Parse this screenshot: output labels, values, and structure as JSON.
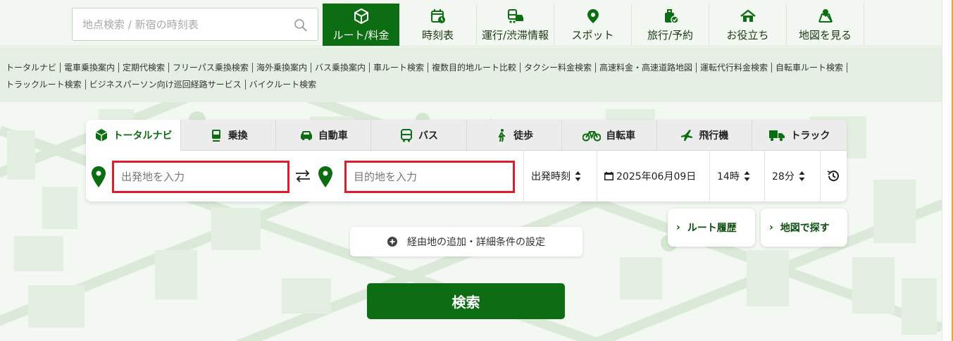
{
  "header": {
    "search_placeholder": "地点検索 / 新宿の時刻表",
    "nav": [
      {
        "label": "ルート/料金",
        "icon": "route-box-icon",
        "active": true
      },
      {
        "label": "時刻表",
        "icon": "calendar-clock-icon"
      },
      {
        "label": "運行/渋滞情報",
        "icon": "train-car-icon"
      },
      {
        "label": "スポット",
        "icon": "pin-icon"
      },
      {
        "label": "旅行/予約",
        "icon": "suitcase-icon"
      },
      {
        "label": "お役立ち",
        "icon": "house-icon"
      },
      {
        "label": "地図を見る",
        "icon": "map-pin-icon"
      }
    ]
  },
  "sublinks": {
    "line1": [
      "トータルナビ",
      "電車乗換案内",
      "定期代検索",
      "フリーパス乗換検索",
      "海外乗換案内",
      "バス乗換案内",
      "車ルート検索",
      "複数目的地ルート比較",
      "タクシー料金検索",
      "高速料金・高速道路地図",
      "運転代行料金検索",
      "自転車ルート検索"
    ],
    "line2": [
      "トラックルート検索",
      "ビジネスパーソン向け巡回経路サービス",
      "バイクルート検索"
    ]
  },
  "tabs": [
    {
      "label": "トータルナビ",
      "icon": "box-icon"
    },
    {
      "label": "乗換",
      "icon": "train-icon"
    },
    {
      "label": "自動車",
      "icon": "car-icon"
    },
    {
      "label": "バス",
      "icon": "bus-icon"
    },
    {
      "label": "徒歩",
      "icon": "walk-icon"
    },
    {
      "label": "自転車",
      "icon": "bicycle-icon"
    },
    {
      "label": "飛行機",
      "icon": "plane-icon"
    },
    {
      "label": "トラック",
      "icon": "truck-icon"
    }
  ],
  "form": {
    "from_placeholder": "出発地を入力",
    "to_placeholder": "目的地を入力",
    "time_mode": "出発時刻",
    "date": "2025年06月09日",
    "hour": "14時",
    "minute": "28分"
  },
  "buttons": {
    "route_history": "ルート履歴",
    "map_search": "地図で探す",
    "details": "経由地の追加・詳細条件の設定",
    "search": "検索"
  },
  "colors": {
    "brand_green": "#0d6d12",
    "highlight_red": "#e11d2b",
    "accent_orange": "#f0a23c"
  }
}
